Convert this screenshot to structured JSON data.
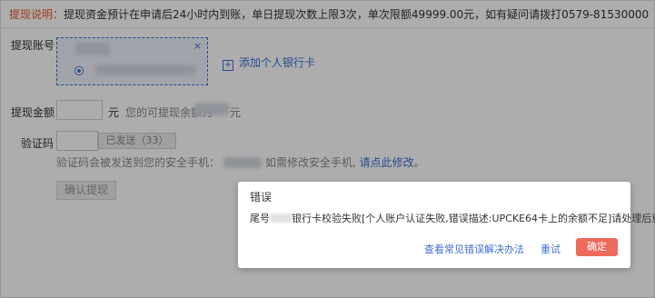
{
  "notice": {
    "label": "提现说明：",
    "text": "提现资金预计在申请后24小时内到账，单日提现次数上限3次，单次限额49999.00元，如有疑问请拨打0579-81530000"
  },
  "form": {
    "account_label": "提现账号：",
    "close_glyph": "×",
    "add_card_label": "添加个人银行卡",
    "amount_label": "提现金额",
    "amount_unit": "元",
    "available_label": "您的可提现余额为",
    "available_unit": "元",
    "code_label": "验证码",
    "sent_label": "已发送（33）",
    "hint_text": "验证码会被发送到您的安全手机：",
    "hint_change": "如需修改安全手机, ",
    "hint_link": "请点此修改",
    "hint_end": "。",
    "confirm_label": "确认提现"
  },
  "dialog": {
    "title": "错误",
    "msg_prefix": "尾号",
    "msg_body": "银行卡校验失败[个人账户认证失败,错误描述:UPCKE64卡上的余额不足]请处理后重试",
    "faq_link": "查看常见错误解决办法",
    "retry_label": "重试",
    "ok_label": "确定"
  },
  "colors": {
    "accent_blue": "#3b6fd1",
    "confirm_red": "#ee6a5d",
    "notice_orange": "#e4572e"
  }
}
